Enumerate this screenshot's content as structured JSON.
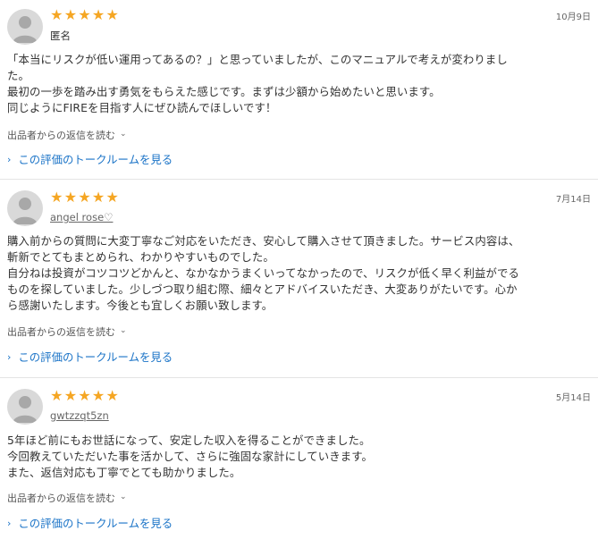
{
  "reviews": [
    {
      "stars": 5,
      "date": "10月9日",
      "user": "匿名",
      "lines": [
        "「本当にリスクが低い運用ってあるの？」と思っていましたが、このマニュアルで考えが変わりまし",
        "た。",
        "最初の一歩を踏み出す勇気をもらえた感じです。まずは少額から始めたいと思います。",
        "同じようにFIREを目指す人にぜひ読んでほしいです！"
      ],
      "reply_label": "出品者からの返信を読む",
      "talk_label": "この評価のトークルームを見る"
    },
    {
      "stars": 5,
      "date": "7月14日",
      "user": "angel rose♡",
      "lines": [
        "購入前からの質問に大変丁寧なご対応をいただき、安心して購入させて頂きました。サービス内容は、",
        "斬新でとてもまとめられ、わかりやすいものでした。",
        "自分ねは投資がコツコツどかんと、なかなかうまくいってなかったので、リスクが低く早く利益がでる",
        "ものを探していました。少しづつ取り組む際、細々とアドバイスいただき、大変ありがたいです。心か",
        "ら感謝いたします。今後とも宜しくお願い致します。"
      ],
      "reply_label": "出品者からの返信を読む",
      "talk_label": "この評価のトークルームを見る"
    },
    {
      "stars": 5,
      "date": "5月14日",
      "user": "gwtzzqt5zn",
      "lines": [
        "5年ほど前にもお世話になって、安定した収入を得ることができました。",
        "今回教えていただいた事を活かして、さらに強固な家計にしていきます。",
        "また、返信対応も丁寧でとても助かりました。"
      ],
      "reply_label": "出品者からの返信を読む",
      "talk_label": "この評価のトークルームを見る"
    }
  ],
  "icons": {
    "star": "star-icon",
    "avatar": "default-user-avatar-icon",
    "chevron": "chevron-down-icon",
    "arrow": "chevron-right-icon"
  },
  "colors": {
    "star": "#f5a623",
    "link": "#1a73c7",
    "divider": "#e4e4e4"
  }
}
